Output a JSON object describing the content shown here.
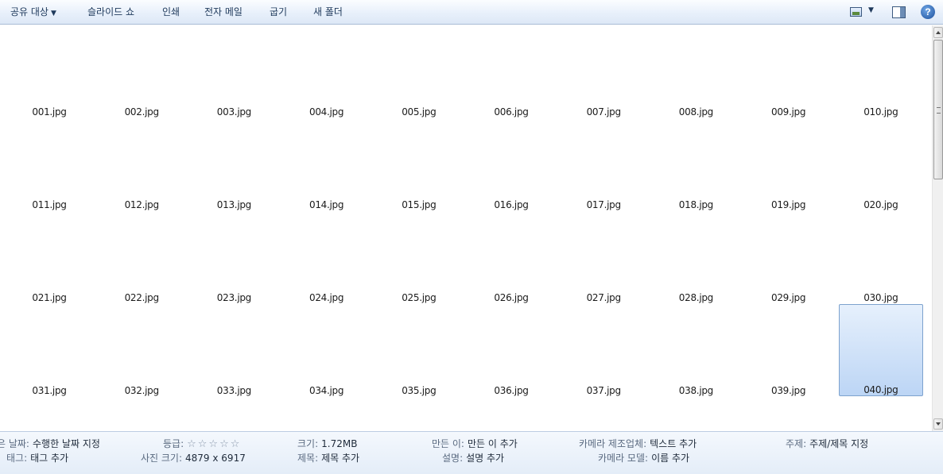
{
  "toolbar": {
    "share": "공유 대상",
    "slideshow": "슬라이드 쇼",
    "print": "인쇄",
    "email": "전자 메일",
    "burn": "굽기",
    "new_folder": "새 폴더",
    "icons": {
      "view": "change-view-icon",
      "preview_pane": "preview-pane-icon",
      "help": "help-icon"
    },
    "help_glyph": "?"
  },
  "files": [
    "001.jpg",
    "002.jpg",
    "003.jpg",
    "004.jpg",
    "005.jpg",
    "006.jpg",
    "007.jpg",
    "008.jpg",
    "009.jpg",
    "010.jpg",
    "011.jpg",
    "012.jpg",
    "013.jpg",
    "014.jpg",
    "015.jpg",
    "016.jpg",
    "017.jpg",
    "018.jpg",
    "019.jpg",
    "020.jpg",
    "021.jpg",
    "022.jpg",
    "023.jpg",
    "024.jpg",
    "025.jpg",
    "026.jpg",
    "027.jpg",
    "028.jpg",
    "029.jpg",
    "030.jpg",
    "031.jpg",
    "032.jpg",
    "033.jpg",
    "034.jpg",
    "035.jpg",
    "036.jpg",
    "037.jpg",
    "038.jpg",
    "039.jpg",
    "040.jpg"
  ],
  "selected_file": "040.jpg",
  "details": {
    "date_key": "은 날짜:",
    "date_val": "수행한 날짜 지정",
    "tags_key": "태그:",
    "tags_val": "태그 추가",
    "rating_key": "등급:",
    "rating_stars": "☆☆☆☆☆",
    "dimensions_key": "사진 크기:",
    "dimensions_val": "4879 x 6917",
    "size_key": "크기:",
    "size_val": "1.72MB",
    "title_key": "제목:",
    "title_val": "제목 추가",
    "author_key": "만든 이:",
    "author_val": "만든 이 추가",
    "desc_key": "설명:",
    "desc_val": "설명 추가",
    "camera_maker_key": "카메라 제조업체:",
    "camera_maker_val": "텍스트 추가",
    "camera_model_key": "카메라 모델:",
    "camera_model_val": "이름 추가",
    "subject_key": "주제:",
    "subject_val": "주제/제목 지정"
  }
}
